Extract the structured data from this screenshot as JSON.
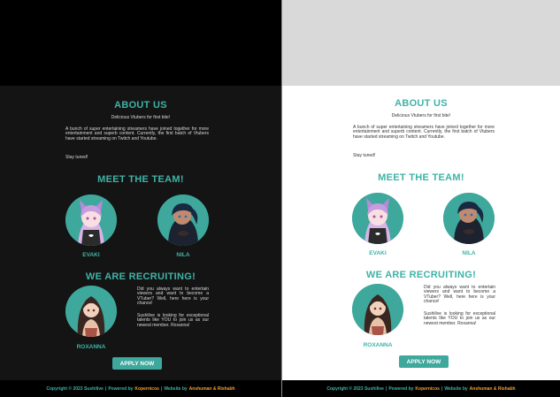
{
  "colors": {
    "accent": "#3fb3a6",
    "highlight": "#f0a030"
  },
  "about": {
    "title": "ABOUT US",
    "subtitle": "Delicious Vtubers for first bite!",
    "body": "A bunch of super entertaining streamers have joined together for more entertainment and superb content. Currently, the first batch of Vtubers have started streaming on Twitch and Youtube.",
    "tagline": "Stay tuned!"
  },
  "team": {
    "title": "MEET THE TEAM!",
    "members": [
      {
        "name": "EVAKI",
        "avatar_icon": "cat-ear-girl-avatar-icon"
      },
      {
        "name": "NILA",
        "avatar_icon": "dark-haired-girl-avatar-icon"
      }
    ]
  },
  "recruit": {
    "title": "WE ARE RECRUITING!",
    "member": {
      "name": "ROXANNA",
      "avatar_icon": "long-haired-girl-avatar-icon"
    },
    "paragraph1": "Did you always want to entertain viewers and want to become a VTuber? Well, here here is your chance!",
    "paragraph2": "Sushilive is looking for exceptional talents like YOU to join us as our newest member. Roxanna!",
    "apply_label": "APPLY NOW"
  },
  "footer": {
    "copyright": "Copyright © 2023 Sushilive",
    "sep1": "|",
    "powered_label": "Powered by",
    "powered_by": "Kopernicos",
    "sep2": "|",
    "website_label": "Website by",
    "website_by": "Anshuman & Rishabh"
  }
}
